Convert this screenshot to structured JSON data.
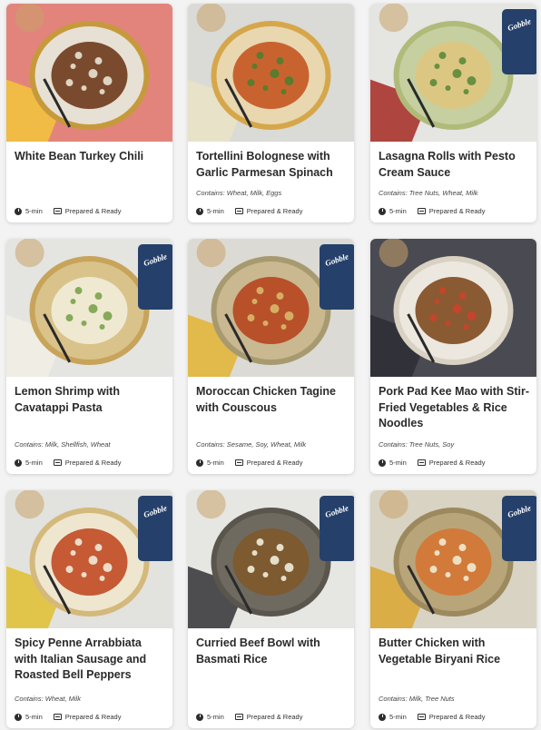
{
  "meals": [
    {
      "title": "White Bean Turkey Chili",
      "contains": "",
      "time": "5-min",
      "prep": "Prepared & Ready",
      "photo": {
        "bg": "#e2847b",
        "plate": "#e7e0d4",
        "rim": "#c69a3c",
        "food": "#7a4a2e",
        "accent": "#e8e4d2",
        "cloth": "#f2c23f",
        "box": false
      }
    },
    {
      "title": "Tortellini Bolognese with Garlic Parmesan Spinach",
      "contains": "Contains: Wheat, Milk, Eggs",
      "time": "5-min",
      "prep": "Prepared & Ready",
      "photo": {
        "bg": "#dadad6",
        "plate": "#e9d7b0",
        "rim": "#d6a74a",
        "food": "#c8632f",
        "accent": "#4f7d2e",
        "cloth": "#e9e2c8",
        "box": false
      }
    },
    {
      "title": "Lasagna Rolls with Pesto Cream Sauce",
      "contains": "Contains: Tree Nuts, Wheat, Milk",
      "time": "5-min",
      "prep": "Prepared & Ready",
      "photo": {
        "bg": "#e5e5e2",
        "plate": "#c5cfa0",
        "rim": "#b0bb7a",
        "food": "#dcc782",
        "accent": "#5b8a3a",
        "cloth": "#a8332d",
        "box": true
      }
    },
    {
      "title": "Lemon Shrimp with Cavatappi Pasta",
      "contains": "Contains: Milk, Shellfish, Wheat",
      "time": "5-min",
      "prep": "Prepared & Ready",
      "photo": {
        "bg": "#e4e4e1",
        "plate": "#d9c38a",
        "rim": "#c7a45a",
        "food": "#efe9d2",
        "accent": "#7aa34a",
        "cloth": "#f0ede4",
        "box": true
      }
    },
    {
      "title": "Moroccan Chicken Tagine with Couscous",
      "contains": "Contains: Sesame, Soy, Wheat, Milk",
      "time": "5-min",
      "prep": "Prepared & Ready",
      "photo": {
        "bg": "#dcdad4",
        "plate": "#c9b890",
        "rim": "#a89a70",
        "food": "#b8502a",
        "accent": "#d8b86a",
        "cloth": "#e2b53c",
        "box": true
      }
    },
    {
      "title": "Pork Pad Kee Mao with Stir-Fried Vegetables & Rice Noodles",
      "contains": "Contains: Tree Nuts, Soy",
      "time": "5-min",
      "prep": "Prepared & Ready",
      "photo": {
        "bg": "#4a4a52",
        "plate": "#ece8df",
        "rim": "#d9d2c3",
        "food": "#8a5a32",
        "accent": "#c9432a",
        "cloth": "#2f2f36",
        "box": false
      }
    },
    {
      "title": "Spicy Penne Arrabbiata with Italian Sausage and Roasted Bell Peppers",
      "contains": "Contains: Wheat, Milk",
      "time": "5-min",
      "prep": "Prepared & Ready",
      "photo": {
        "bg": "#e2e2de",
        "plate": "#efe6cf",
        "rim": "#d4b97c",
        "food": "#c55a35",
        "accent": "#f0ead8",
        "cloth": "#e0c23a",
        "box": true
      }
    },
    {
      "title": "Curried Beef Bowl with Basmati Rice",
      "contains": "",
      "time": "5-min",
      "prep": "Prepared & Ready",
      "photo": {
        "bg": "#e6e6e2",
        "plate": "#6f6a60",
        "rim": "#5a564e",
        "food": "#7d5a2f",
        "accent": "#f1ecdc",
        "cloth": "#3c3c40",
        "box": true
      }
    },
    {
      "title": "Butter Chicken with Vegetable Biryani Rice",
      "contains": "Contains: Milk, Tree Nuts",
      "time": "5-min",
      "prep": "Prepared & Ready",
      "photo": {
        "bg": "#d9d3c4",
        "plate": "#b9a57a",
        "rim": "#9c8a5e",
        "food": "#d27a3a",
        "accent": "#f1ead2",
        "cloth": "#d9a93a",
        "box": true
      }
    }
  ],
  "brand": {
    "box_label": "Gobble",
    "box_color": "#25416b"
  }
}
